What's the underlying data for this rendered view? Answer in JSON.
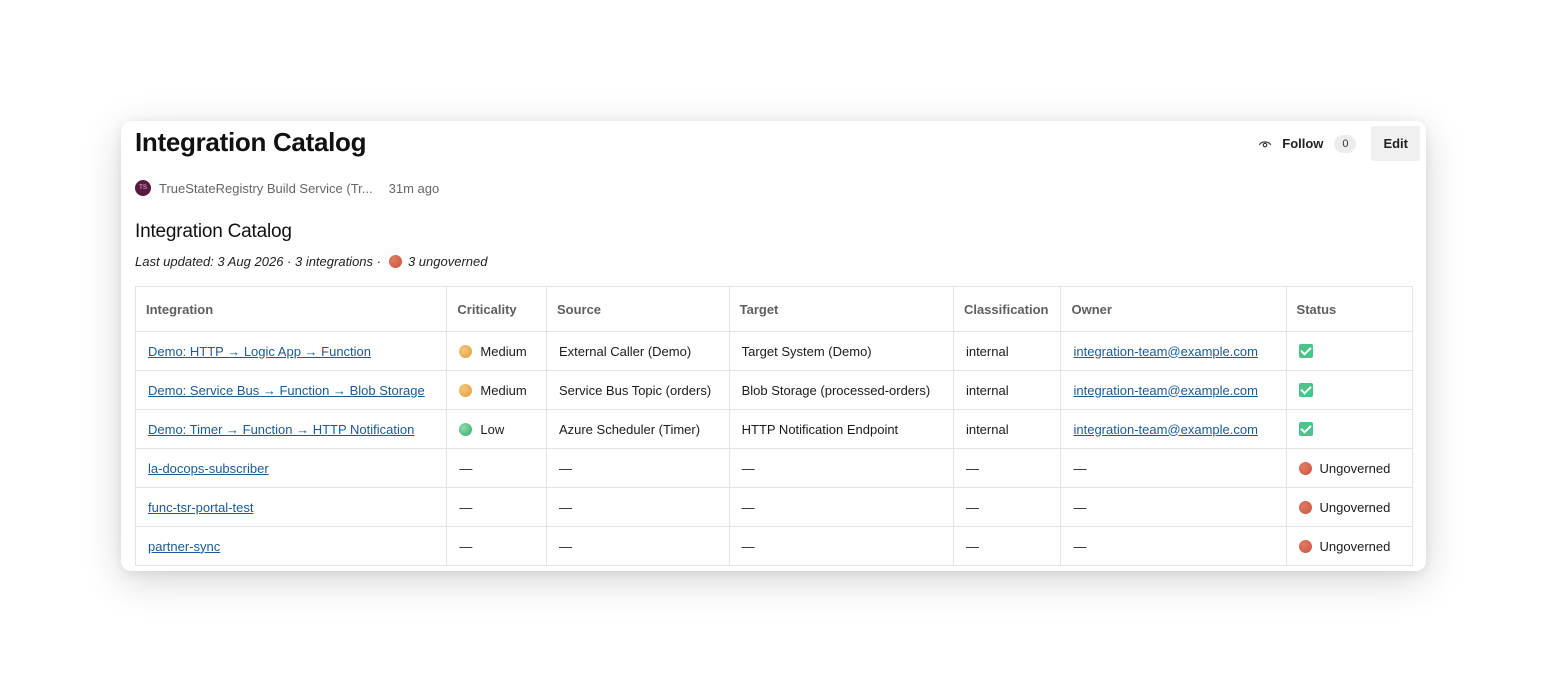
{
  "header": {
    "title": "Integration Catalog",
    "follow_label": "Follow",
    "follow_count": "0",
    "edit_label": "Edit"
  },
  "author": {
    "initials": "TS",
    "name": "TrueStateRegistry Build Service (Tr...",
    "time_ago": "31m ago"
  },
  "content": {
    "heading": "Integration Catalog",
    "meta_prefix": "Last updated: 3 Aug 2026 · 3 integrations ·",
    "meta_ungoverned": "3 ungoverned"
  },
  "colors": {
    "link": "#1a5a96",
    "status_ok": "#4cc38a",
    "ungoverned": "#d4614a",
    "medium": "#eaa84e",
    "low": "#3cb371"
  },
  "table": {
    "columns": [
      "Integration",
      "Criticality",
      "Source",
      "Target",
      "Classification",
      "Owner",
      "Status"
    ],
    "rows": [
      {
        "integration": "Demo: HTTP → Logic App → Function",
        "criticality": "Medium",
        "criticality_icon": "orange-circle-icon",
        "source": "External Caller (Demo)",
        "target": "Target System (Demo)",
        "classification": "internal",
        "owner": "integration-team@example.com",
        "status_icon": "check-mark-icon",
        "status": ""
      },
      {
        "integration": "Demo: Service Bus → Function → Blob Storage",
        "criticality": "Medium",
        "criticality_icon": "orange-circle-icon",
        "source": "Service Bus Topic (orders)",
        "target": "Blob Storage (processed-orders)",
        "classification": "internal",
        "owner": "integration-team@example.com",
        "status_icon": "check-mark-icon",
        "status": ""
      },
      {
        "integration": "Demo: Timer → Function → HTTP Notification",
        "criticality": "Low",
        "criticality_icon": "green-circle-icon",
        "source": "Azure Scheduler (Timer)",
        "target": "HTTP Notification Endpoint",
        "classification": "internal",
        "owner": "integration-team@example.com",
        "status_icon": "check-mark-icon",
        "status": ""
      },
      {
        "integration": "la-docops-subscriber",
        "criticality": "—",
        "criticality_icon": "",
        "source": "—",
        "target": "—",
        "classification": "—",
        "owner": "—",
        "status_icon": "red-circle-icon",
        "status": "Ungoverned"
      },
      {
        "integration": "func-tsr-portal-test",
        "criticality": "—",
        "criticality_icon": "",
        "source": "—",
        "target": "—",
        "classification": "—",
        "owner": "—",
        "status_icon": "red-circle-icon",
        "status": "Ungoverned"
      },
      {
        "integration": "partner-sync",
        "criticality": "—",
        "criticality_icon": "",
        "source": "—",
        "target": "—",
        "classification": "—",
        "owner": "—",
        "status_icon": "red-circle-icon",
        "status": "Ungoverned"
      }
    ]
  }
}
